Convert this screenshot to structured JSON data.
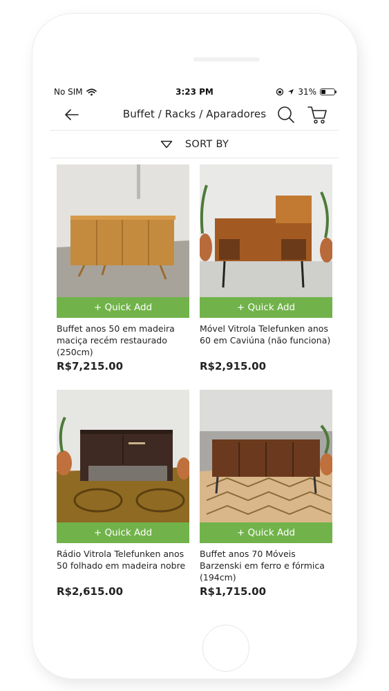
{
  "status_bar": {
    "carrier": "No SIM",
    "time": "3:23 PM",
    "battery_percent": "31%",
    "battery_level": 0.31,
    "icons": [
      "wifi-icon",
      "orientation-lock-icon",
      "location-arrow-icon",
      "battery-icon"
    ]
  },
  "header": {
    "title": "Buffet / Racks / Aparadores",
    "back_icon": "arrow-left-icon",
    "search_icon": "search-icon",
    "cart_icon": "cart-icon"
  },
  "sort": {
    "label": "SORT BY",
    "icon": "triangle-down-icon"
  },
  "colors": {
    "accent": "#71b34a",
    "text": "#222222",
    "divider": "#e8e8e8"
  },
  "products": [
    {
      "quick_add": "+ Quick Add",
      "name": "Buffet anos 50 em madeira maciça recém restaurado (250cm)",
      "price": "R$7,215.00"
    },
    {
      "quick_add": "+ Quick Add",
      "name": "Móvel Vitrola Telefunken anos 60 em Caviúna (não funciona)",
      "price": "R$2,915.00"
    },
    {
      "quick_add": "+ Quick Add",
      "name": "Rádio Vitrola Telefunken anos 50 folhado em madeira nobre",
      "price": "R$2,615.00"
    },
    {
      "quick_add": "+ Quick Add",
      "name": "Buffet anos 70 Móveis Barzenski em ferro e fórmica (194cm)",
      "price": "R$1,715.00"
    }
  ]
}
